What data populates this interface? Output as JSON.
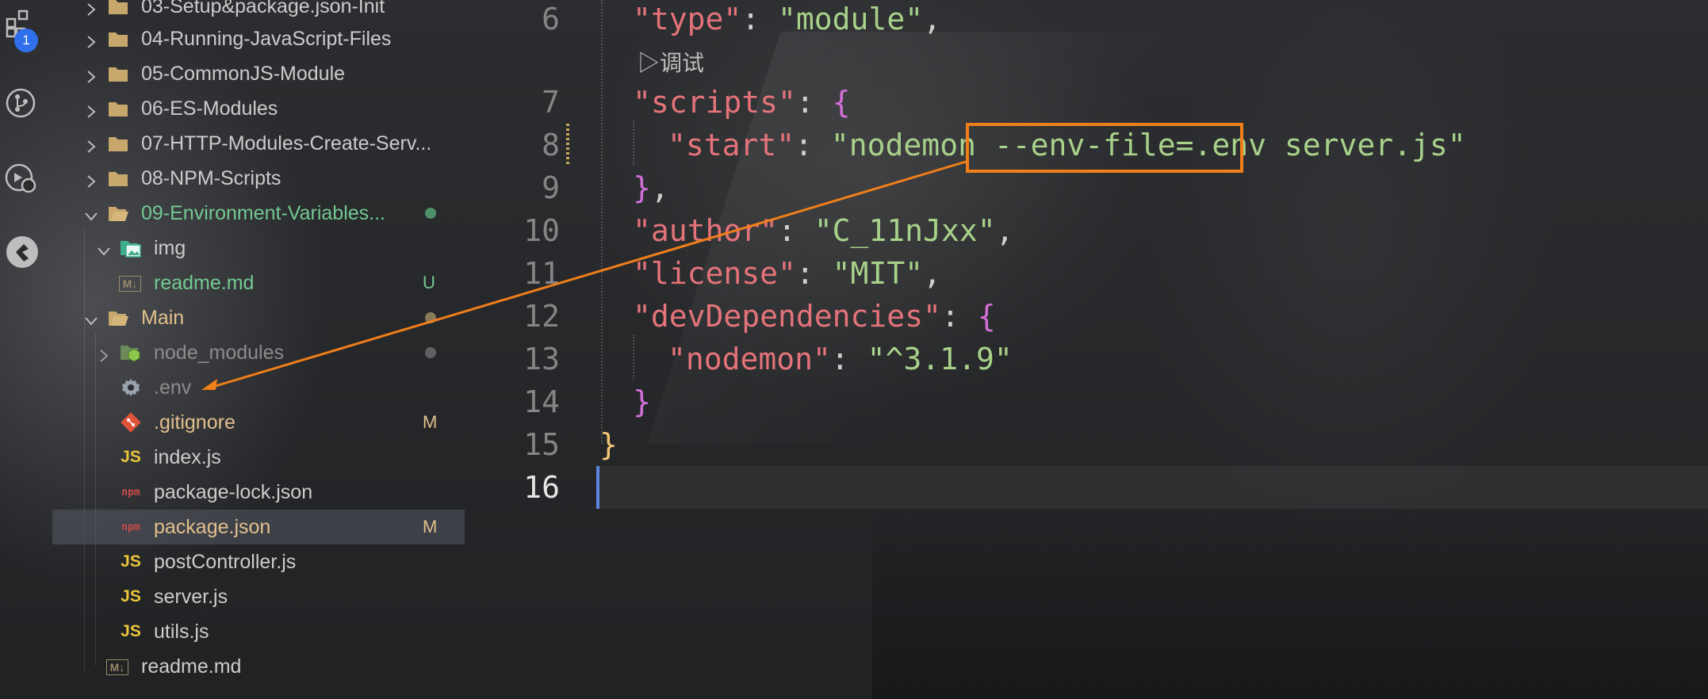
{
  "activity": {
    "badge_count": "1"
  },
  "explorer": {
    "items": [
      {
        "label": "03-Setup&package.json-Init",
        "type": "folder",
        "expanded": false,
        "color": "#cccccc"
      },
      {
        "label": "04-Running-JavaScript-Files",
        "type": "folder",
        "expanded": false,
        "color": "#cccccc"
      },
      {
        "label": "05-CommonJS-Module",
        "type": "folder",
        "expanded": false,
        "color": "#cccccc"
      },
      {
        "label": "06-ES-Modules",
        "type": "folder",
        "expanded": false,
        "color": "#cccccc"
      },
      {
        "label": "07-HTTP-Modules-Create-Serv...",
        "type": "folder",
        "expanded": false,
        "color": "#cccccc"
      },
      {
        "label": "08-NPM-Scripts",
        "type": "folder",
        "expanded": false,
        "color": "#cccccc"
      },
      {
        "label": "09-Environment-Variables...",
        "type": "folder",
        "expanded": true,
        "color": "#73c991"
      },
      {
        "label": "img",
        "type": "image-folder",
        "expanded": true,
        "color": "#cccccc"
      },
      {
        "label": "readme.md",
        "type": "markdown",
        "status": "U",
        "color": "#73c991"
      },
      {
        "label": "Main",
        "type": "folder",
        "expanded": true,
        "color": "#e2c08d"
      },
      {
        "label": "node_modules",
        "type": "node-folder",
        "expanded": false,
        "color": "#8c8c8c"
      },
      {
        "label": ".env",
        "type": "settings",
        "color": "#8c8c8c"
      },
      {
        "label": ".gitignore",
        "type": "git",
        "status": "M",
        "color": "#e2c08d"
      },
      {
        "label": "index.js",
        "type": "js",
        "color": "#cccccc"
      },
      {
        "label": "package-lock.json",
        "type": "npm",
        "color": "#cccccc"
      },
      {
        "label": "package.json",
        "type": "npm",
        "status": "M",
        "color": "#e2c08d",
        "selected": true
      },
      {
        "label": "postController.js",
        "type": "js",
        "color": "#cccccc"
      },
      {
        "label": "server.js",
        "type": "js",
        "color": "#cccccc"
      },
      {
        "label": "utils.js",
        "type": "js",
        "color": "#cccccc"
      },
      {
        "label": "readme.md",
        "type": "markdown",
        "color": "#cccccc"
      }
    ],
    "js_icon_text": "JS",
    "npm_icon_text": "npm",
    "md_icon_text": "M↓"
  },
  "editor": {
    "line_numbers": [
      "6",
      "7",
      "8",
      "9",
      "10",
      "11",
      "12",
      "13",
      "14",
      "15",
      "16"
    ],
    "active_line": "16",
    "codelens": "▷调试",
    "tokens": {
      "l6_key": "\"type\"",
      "l6_colon": ": ",
      "l6_val": "\"module\"",
      "l6_comma": ",",
      "l7_key": "\"scripts\"",
      "l7_colon": ": ",
      "l7_brace": "{",
      "l8_key": "\"start\"",
      "l8_colon": ": ",
      "l8_val_a": "\"nodemon ",
      "l8_val_b": "--env-file=.env",
      "l8_val_c": " server.js\"",
      "l9_brace": "}",
      "l9_comma": ",",
      "l10_key": "\"author\"",
      "l10_colon": ": ",
      "l10_val": "\"C_11nJxx\"",
      "l10_comma": ",",
      "l11_key": "\"license\"",
      "l11_colon": ": ",
      "l11_val": "\"MIT\"",
      "l11_comma": ",",
      "l12_key": "\"devDependencies\"",
      "l12_colon": ": ",
      "l12_brace": "{",
      "l13_key": "\"nodemon\"",
      "l13_colon": ": ",
      "l13_val": "\"^3.1.9\"",
      "l14_brace": "}",
      "l15_brace": "}"
    }
  },
  "annotation": {
    "color": "#f07f1a"
  }
}
